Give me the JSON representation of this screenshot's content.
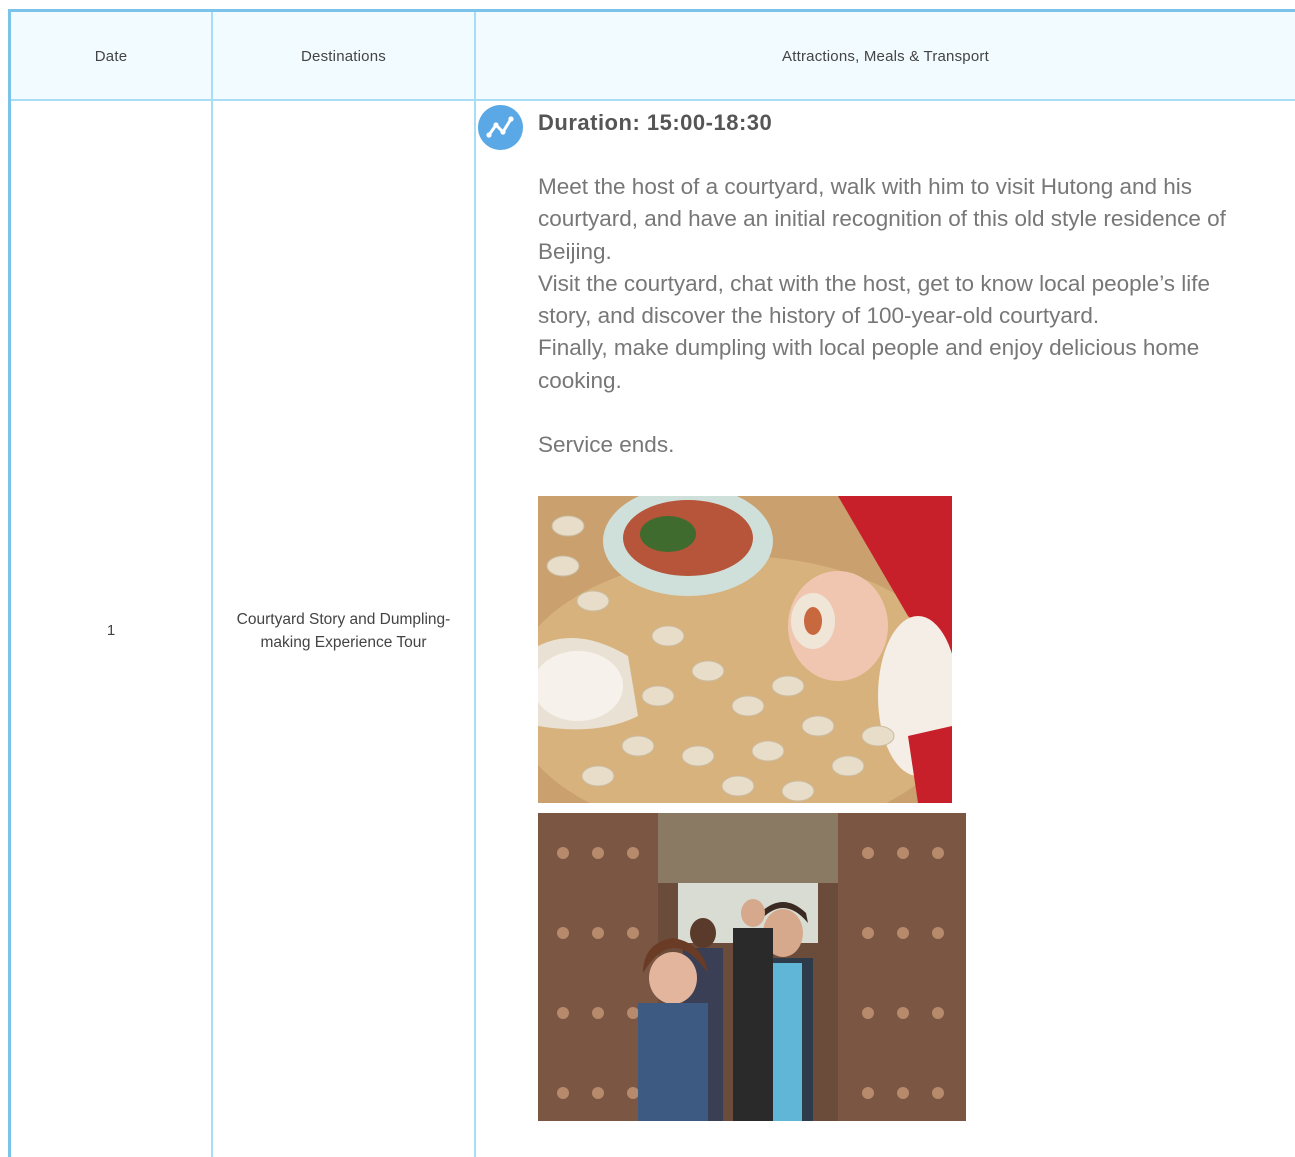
{
  "table": {
    "headers": {
      "date": "Date",
      "destinations": "Destinations",
      "attractions": "Attractions, Meals & Transport"
    },
    "rows": [
      {
        "date": "1",
        "destination": "Courtyard Story and Dumpling-making Experience Tour",
        "duration": "Duration: 15:00-18:30",
        "description": [
          "Meet the host of a courtyard, walk with him to visit Hutong and his courtyard, and have an initial recognition of this old style residence of Beijing.",
          "Visit the courtyard, chat with the host, get to know local people’s life story, and discover the history of 100-year-old courtyard.",
          "Finally, make dumpling with local people and enjoy delicious home cooking."
        ],
        "closing": "Service ends.",
        "icon": "route-icon",
        "accent_color": "#5aa9e6"
      }
    ]
  }
}
